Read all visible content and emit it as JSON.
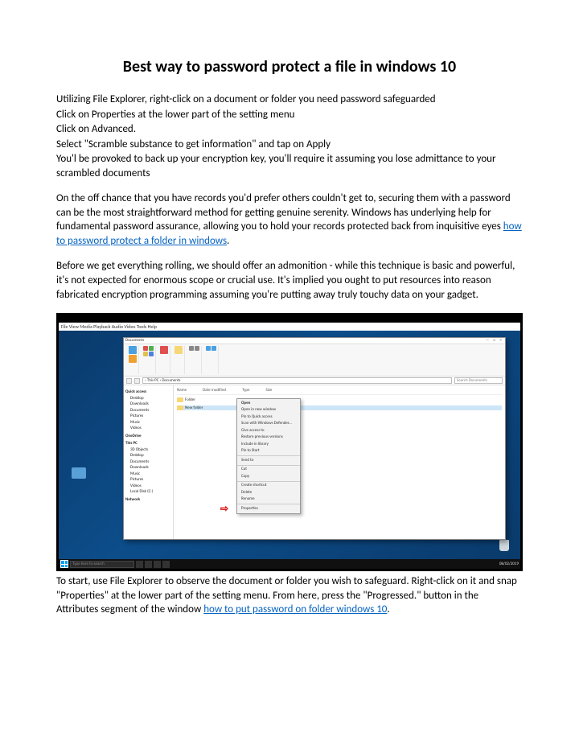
{
  "title": "Best way to password protect a file in windows 10",
  "intro": [
    "Utilizing File Explorer, right-click on a document or folder you need password safeguarded",
    "Click on Properties at the lower part of the setting menu",
    "Click on Advanced.",
    "Select \"Scramble substance to get information\" and tap on Apply",
    "You'l be provoked to back up your encryption key, you'll require it assuming you lose admittance to your scrambled documents"
  ],
  "para1_a": "On the off chance that you have records you'd prefer others couldn't get to, securing them with a password can be the most straightforward method for getting genuine serenity. Windows has underlying help for fundamental password assurance, allowing you to hold your records protected back from inquisitive eyes ",
  "link1": "how to password protect a folder in windows",
  "para1_b": ".",
  "para2": "Before we get everything rolling, we should offer an admonition - while this technique is basic and powerful, it's not expected for enormous scope or crucial use. It's implied you ought to put resources into reason fabricated encryption programming assuming you're putting away truly touchy data on your gadget.",
  "para3_a": "To start, use File Explorer to observe the document or folder you wish to safeguard. Right-click on it and snap \"Properties\" at the lower part of the setting menu. From here, press the \"Progressed.\" button in the Attributes segment of the window ",
  "link2": "how to put password on folder windows 10",
  "para3_b": ".",
  "shot": {
    "menubar": "File   View   Media   Playback   Audio   Video   Tools   Help",
    "explorer_title_left": "Documents",
    "explorer_title_right": "—  □  ×",
    "addr_path": "› This PC › Documents",
    "search_ph": "Search Documents",
    "cols": [
      "Name",
      "Date modified",
      "Type",
      "Size"
    ],
    "side": {
      "quick": "Quick access",
      "quick_items": [
        "Desktop",
        "Downloads",
        "Documents",
        "Pictures",
        "Music",
        "Videos"
      ],
      "onedrive": "OneDrive",
      "thispc": "This PC",
      "thispc_items": [
        "3D Objects",
        "Desktop",
        "Documents",
        "Downloads",
        "Music",
        "Pictures",
        "Videos",
        "Local Disk (C:)"
      ],
      "network": "Network"
    },
    "folder1": "Folder",
    "folder2": "New folder",
    "ctx": [
      {
        "t": "Open",
        "b": true
      },
      {
        "t": "Open in new window"
      },
      {
        "t": "Pin to Quick access"
      },
      {
        "t": "Scan with Windows Defender..."
      },
      {
        "t": "Give access to"
      },
      {
        "t": "Restore previous versions"
      },
      {
        "t": "Include in library"
      },
      {
        "t": "Pin to Start"
      },
      {
        "sep": true
      },
      {
        "t": "Send to"
      },
      {
        "sep": true
      },
      {
        "t": "Cut"
      },
      {
        "t": "Copy"
      },
      {
        "sep": true
      },
      {
        "t": "Create shortcut"
      },
      {
        "t": "Delete"
      },
      {
        "t": "Rename"
      },
      {
        "sep": true
      },
      {
        "t": "Properties"
      }
    ],
    "taskbar_search": "Type here to search",
    "taskbar_time": "08/02/2019"
  }
}
